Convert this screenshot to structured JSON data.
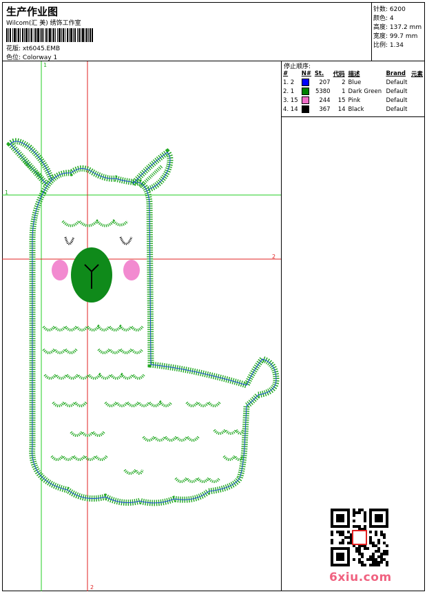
{
  "header": {
    "title": "生产作业图",
    "subtitle": "Wilcom(汇 美) 绣饰工作室",
    "pattern_label": "花版:",
    "pattern_value": "xt6045.EMB",
    "colorway_label": "色位:",
    "colorway_value": "Colorway 1"
  },
  "stats": [
    {
      "label": "针数:",
      "value": "6200"
    },
    {
      "label": "颜色:",
      "value": "4"
    },
    {
      "label": "高度:",
      "value": "137.2 mm"
    },
    {
      "label": "宽度:",
      "value": "99.7 mm"
    },
    {
      "label": "比例:",
      "value": "1.34"
    }
  ],
  "canvas": {
    "guide_v1": "1",
    "guide_h1": "1",
    "guide_h2": "2",
    "guide_v2": "2"
  },
  "stop_sequence": {
    "title": "停止顺序:",
    "headers": {
      "num": "#",
      "n": "N#",
      "st": "St.",
      "code": "代码",
      "desc": "描述",
      "brand": "Brand",
      "element": "元素"
    },
    "rows": [
      {
        "num": "1. 2",
        "color": "#0000ff",
        "st": "207",
        "code": "2",
        "desc": "Blue",
        "brand": "Default"
      },
      {
        "num": "2. 1",
        "color": "#008000",
        "st": "5380",
        "code": "1",
        "desc": "Dark Green",
        "brand": "Default"
      },
      {
        "num": "3. 15",
        "color": "#f06cc8",
        "st": "244",
        "code": "15",
        "desc": "Pink",
        "brand": "Default"
      },
      {
        "num": "4. 14",
        "color": "#000000",
        "st": "367",
        "code": "14",
        "desc": "Black",
        "brand": "Default"
      }
    ]
  },
  "watermark": {
    "text": "6xiu.com"
  },
  "colors": {
    "green": "#22a822",
    "blue": "#1a4fd6",
    "red": "#e02020",
    "guide_green": "#22cc22",
    "pink": "#f28ad0"
  }
}
